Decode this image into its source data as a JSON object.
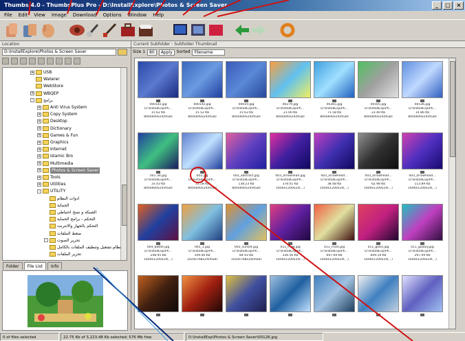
{
  "window": {
    "title": "Thumbs 4.0 - ThumbsPlus Pro - D:\\InstallExplore\\Photos & Screen Saver",
    "buttons": [
      "_",
      "□",
      "×"
    ]
  },
  "menu": [
    "File",
    "Edit",
    "View",
    "Image",
    "Download",
    "Options",
    "Window",
    "Help"
  ],
  "toolbar": {
    "icons": [
      "open-icon",
      "copy-icon",
      "move-icon",
      "eye-icon",
      "brush-icon",
      "brush2-icon",
      "briefcase-icon",
      "folder-view-icon",
      "monitor-icon",
      "slideshow-icon",
      "red-screen-icon",
      "back-arrow-icon",
      "forward-arrow-icon",
      "ring-icon"
    ]
  },
  "left": {
    "header": "Location",
    "address": "D:\\InstallExplore\\Photos & Screen Saver",
    "tree": [
      {
        "label": "USB",
        "expander": "+"
      },
      {
        "label": "Waterer",
        "expander": ""
      },
      {
        "label": "WebStore",
        "expander": ""
      },
      {
        "label": "WBQEP",
        "expander": "+"
      },
      {
        "label": "برامج",
        "expander": "-"
      },
      {
        "label": "Anti Virus System",
        "expander": "+"
      },
      {
        "label": "Copy System",
        "expander": "+"
      },
      {
        "label": "Desktop",
        "expander": "+"
      },
      {
        "label": "Dictionary",
        "expander": "+"
      },
      {
        "label": "Games & Fun",
        "expander": "+"
      },
      {
        "label": "Graphics",
        "expander": "+"
      },
      {
        "label": "Internet",
        "expander": "+"
      },
      {
        "label": "Islamic Bro",
        "expander": "+"
      },
      {
        "label": "Multimedia",
        "expander": "+"
      },
      {
        "label": "Photos & Screen Saver",
        "expander": "+",
        "selected": true
      },
      {
        "label": "Tools",
        "expander": "+"
      },
      {
        "label": "Utilities",
        "expander": "+"
      },
      {
        "label": "UTILITY",
        "expander": "-"
      },
      {
        "label": "ادوات النظام",
        "expander": ""
      },
      {
        "label": "الحماية",
        "expander": ""
      },
      {
        "label": "الشبكة و نسخ احتياطي",
        "expander": ""
      },
      {
        "label": "التحكم - برامج الحماية",
        "expander": ""
      },
      {
        "label": "التحكم بالجهاز والانترنت",
        "expander": ""
      },
      {
        "label": "ضغط الملفات",
        "expander": ""
      },
      {
        "label": "تحرير الصوت",
        "expander": "-"
      },
      {
        "label": "نظام تشغيل وتنظيف الملفات بالكامل",
        "expander": ""
      },
      {
        "label": "تحرير الملفات",
        "expander": ""
      }
    ],
    "tabs": [
      "Folder",
      "File List",
      "Info"
    ],
    "preview_icon": "garden-image"
  },
  "right": {
    "header": "Current Subfolder : Subfolder Thumbnail",
    "size_label": "Size 1",
    "size_value": "80",
    "sort_label": "Apply",
    "type_label": "Sorted",
    "type_value": "Filename"
  },
  "thumbnails": [
    {
      "name": "00014z.jpg",
      "path": "D:\\InstallExp\\Ph...",
      "size": "15.62 Kb",
      "dims": "800x600x24(RGB)",
      "colors": [
        "#2a4aa8",
        "#5a7ad0",
        "#1a2a80"
      ]
    },
    {
      "name": "00014z.jpg",
      "path": "D:\\InstallExp\\Ph...",
      "size": "15.52 Kb",
      "dims": "800x600x24(RGB)",
      "colors": [
        "#3a6ac0",
        "#6a9ae0",
        "#2040a0"
      ]
    },
    {
      "name": "00019.jpg",
      "path": "D:\\InstallExp\\Ph...",
      "size": "15.63 Kb",
      "dims": "800x600x24(RGB)",
      "colors": [
        "#3a5ab8",
        "#5a88d8",
        "#28489a"
      ]
    },
    {
      "name": "00279.jpg",
      "path": "D:\\InstallExp\\Ph...",
      "size": "21.00 Kb",
      "dims": "800x600x24(RGB)",
      "colors": [
        "#f8a040",
        "#60c0f0",
        "#f0f060"
      ]
    },
    {
      "name": "00365.jpg",
      "path": "D:\\InstallExp\\Ph...",
      "size": "71.58 Kb",
      "dims": "800x600x24(RGB)",
      "colors": [
        "#40a0e0",
        "#a0e0ff",
        "#2060c0"
      ]
    },
    {
      "name": "00505.jpg",
      "path": "D:\\InstallExp\\Ph...",
      "size": "23.40 Kb",
      "dims": "800x600x24(RGB)",
      "colors": [
        "#50c060",
        "#a0a0a0",
        "#e0e0e0"
      ]
    },
    {
      "name": "00536.jpg",
      "path": "D:\\InstallExp\\Ph...",
      "size": "14.86 Kb",
      "dims": "800x600x24(RGB)",
      "colors": [
        "#6090e0",
        "#c0d8ff",
        "#3060c0"
      ]
    },
    {
      "name": "001.3d.jpg",
      "path": "D:\\InstallExp\\Ph...",
      "size": "33.43 Kb",
      "dims": "800x600x24(RGB)",
      "colors": [
        "#2040a0",
        "#40c080",
        "#1a1a60"
      ]
    },
    {
      "name": "002.jpg",
      "path": "D:\\InstallExp\\Ph...",
      "size": "31.58 Kb",
      "dims": "800x600x24(RGB)",
      "colors": [
        "#6080d0",
        "#c0e0ff",
        "#2040a0"
      ]
    },
    {
      "name": "002_abstract.jpg",
      "path": "D:\\InstallExp\\Ph...",
      "size": "138.23 Kb",
      "dims": "800x600x24(RGB)",
      "colors": [
        "#e060a0",
        "#6040c0",
        "#2020a0"
      ]
    },
    {
      "name": "003_arrowhead.jpg",
      "path": "D:\\InstallExp\\Ph...",
      "size": "378.01 Kb",
      "dims": "1600x1200x24(...)",
      "colors": [
        "#e030a0",
        "#4020a0",
        "#100860"
      ]
    },
    {
      "name": "003_arrowhead...",
      "path": "D:\\InstallExp\\Ph...",
      "size": "38.48 Kb",
      "dims": "1600x1200x24(...)",
      "colors": [
        "#c040c0",
        "#4030b0",
        "#100860"
      ]
    },
    {
      "name": "003_arrowhead...",
      "path": "D:\\InstallExp\\Ph...",
      "size": "62.98 Kb",
      "dims": "1600x1200x24(...)",
      "colors": [
        "#909090",
        "#303030",
        "#101010"
      ]
    },
    {
      "name": "003_arrowhead...",
      "path": "D:\\InstallExp\\Ph...",
      "size": "113.89 Kb",
      "dims": "1600x1200x24(...)",
      "colors": [
        "#d040b0",
        "#5030c0",
        "#180a70"
      ]
    },
    {
      "name": "004_battle.jpg",
      "path": "D:\\InstallExp\\Ph...",
      "size": "248.95 Kb",
      "dims": "1600x1200x24(...)",
      "colors": [
        "#e06020",
        "#2040a0",
        "#601040"
      ]
    },
    {
      "name": "005_1.jpg",
      "path": "D:\\InstallExp\\Ph...",
      "size": "109.46 Kb",
      "dims": "1024x768x24(RGB)",
      "colors": [
        "#f0a040",
        "#80c0e0",
        "#204080"
      ]
    },
    {
      "name": "005_sunset.jpg",
      "path": "D:\\InstallExp\\Ph...",
      "size": "84.93 Kb",
      "dims": "1024x768x24(RGB)",
      "colors": [
        "#e09030",
        "#60a0e0",
        "#e0c060"
      ]
    },
    {
      "name": "011_Flow.jpg",
      "path": "D:\\InstallExp\\Ph...",
      "size": "336.56 Kb",
      "dims": "1600x1200x24(...)",
      "colors": [
        "#e04080",
        "#6020a0",
        "#200840"
      ]
    },
    {
      "name": "011_Frost.jpg",
      "path": "D:\\InstallExp\\Ph...",
      "size": "697.69 Kb",
      "dims": "1600x1200x24(...)",
      "colors": [
        "#f06040",
        "#e0e0a0",
        "#401010"
      ]
    },
    {
      "name": "011_glass.jpg",
      "path": "D:\\InstallExp\\Ph...",
      "size": "609.19 Kb",
      "dims": "1600x1200x24(...)",
      "colors": [
        "#e04060",
        "#c02080",
        "#200830"
      ]
    },
    {
      "name": "011_galaxy.jpg",
      "path": "D:\\InstallExp\\Ph...",
      "size": "297.09 Kb",
      "dims": "1600x1200x24(...)",
      "colors": [
        "#20c0c0",
        "#c040c0",
        "#301040"
      ]
    },
    {
      "name": "",
      "path": "",
      "size": "",
      "dims": "",
      "colors": [
        "#c06020",
        "#402010",
        "#100808"
      ]
    },
    {
      "name": "",
      "path": "",
      "size": "",
      "dims": "",
      "colors": [
        "#f09040",
        "#a02010",
        "#200808"
      ]
    },
    {
      "name": "",
      "path": "",
      "size": "",
      "dims": "",
      "colors": [
        "#e0c040",
        "#4050a0",
        "#202050"
      ]
    },
    {
      "name": "",
      "path": "",
      "size": "",
      "dims": "",
      "colors": [
        "#a0c0e0",
        "#2060a0",
        "#c0e0ff"
      ]
    },
    {
      "name": "",
      "path": "",
      "size": "",
      "dims": "",
      "colors": [
        "#4080c0",
        "#a0c0e0",
        "#204060"
      ]
    },
    {
      "name": "",
      "path": "",
      "size": "",
      "dims": "",
      "colors": [
        "#f0f0f0",
        "#4080c0",
        "#c0d0e0"
      ]
    },
    {
      "name": "",
      "path": "",
      "size": "",
      "dims": "",
      "colors": [
        "#e0e0ff",
        "#6060c0",
        "#a0c0f0"
      ]
    }
  ],
  "status": {
    "selection": "0 of files selected",
    "disk": "22.75 Kb of 3,223.48 Kb selected; 576 Mb free",
    "path": "D:\\InstallExp\\Photos & Screen Saver\\00126.jpg"
  }
}
